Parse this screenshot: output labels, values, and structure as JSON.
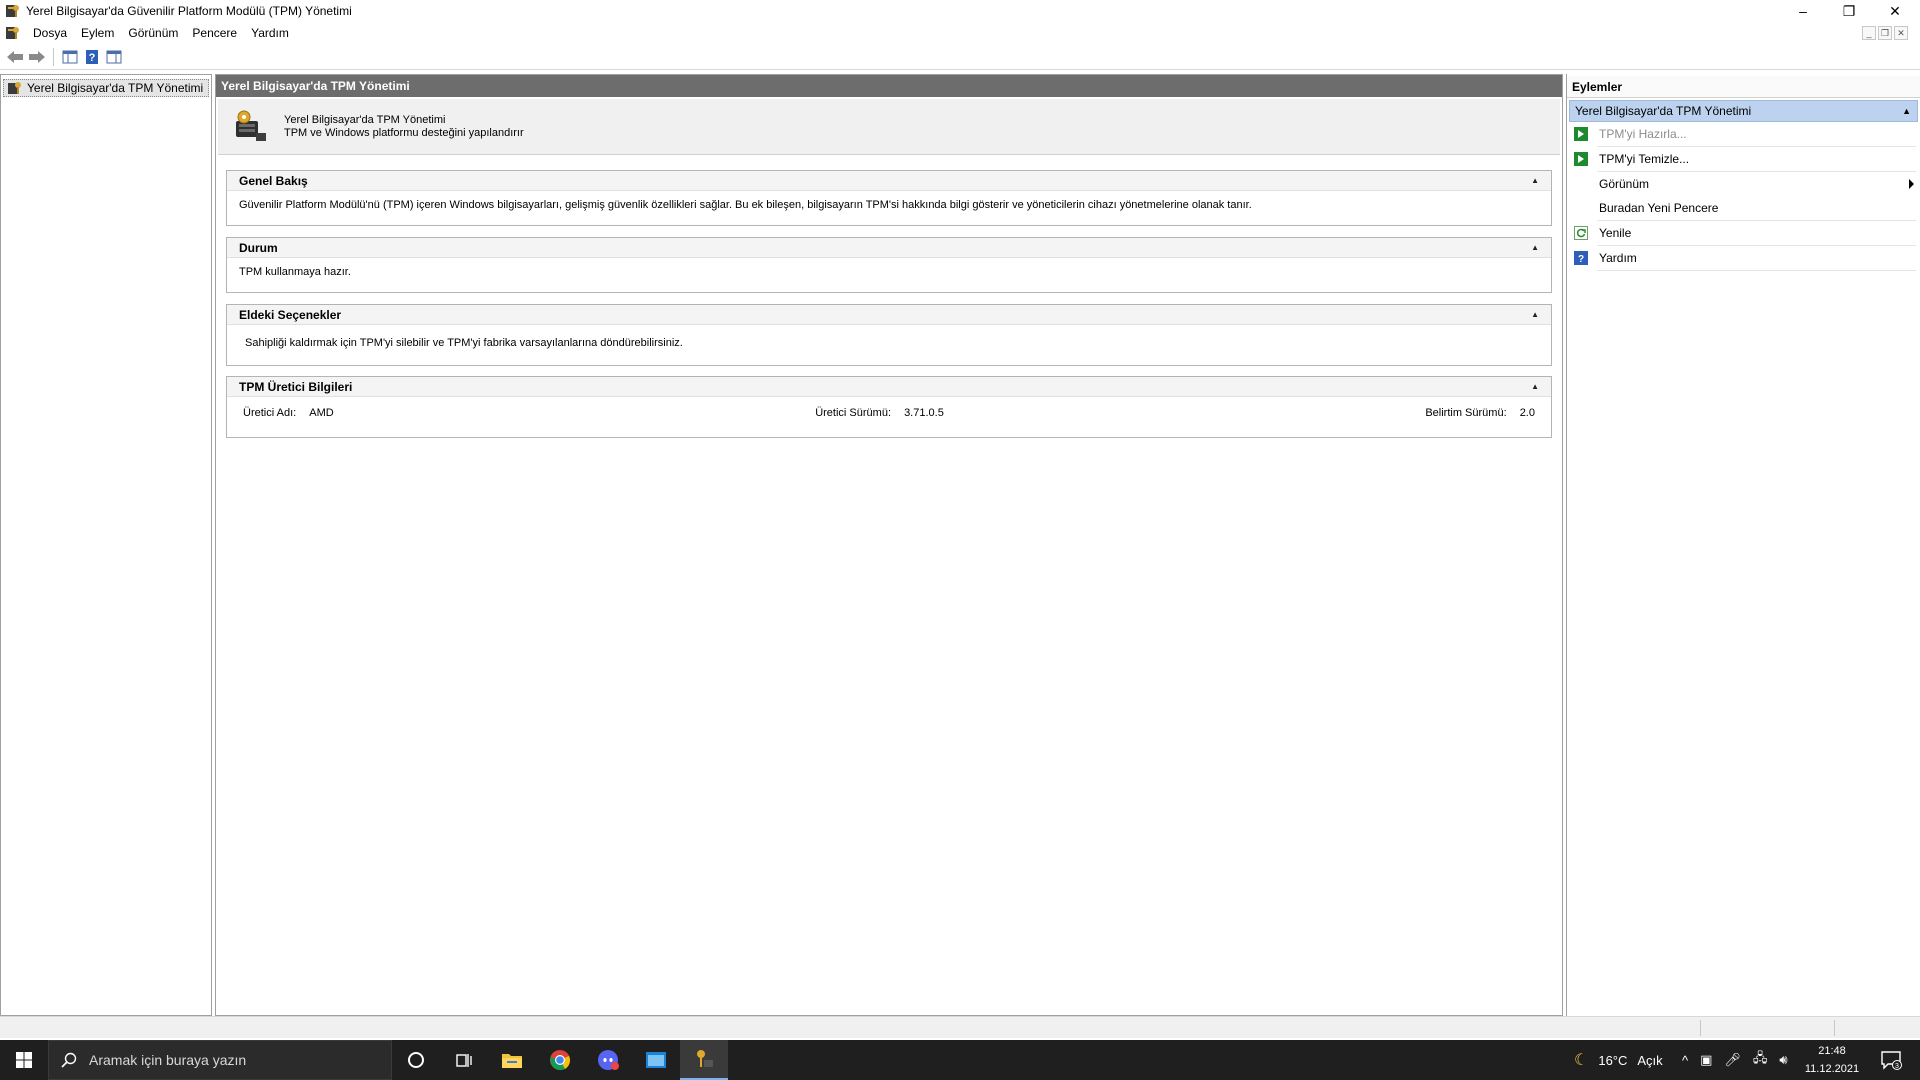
{
  "window": {
    "title": "Yerel Bilgisayar'da Güvenilir Platform Modülü (TPM) Yönetimi",
    "minimize_glyph": "–",
    "maximize_glyph": "❐",
    "close_glyph": "✕",
    "mdi_minimize_glyph": "_",
    "mdi_restore_glyph": "❐",
    "mdi_close_glyph": "✕"
  },
  "menubar": {
    "items": [
      "Dosya",
      "Eylem",
      "Görünüm",
      "Pencere",
      "Yardım"
    ]
  },
  "toolbar": {
    "buttons": [
      "back-icon",
      "forward-icon",
      "show-hide-tree-icon",
      "help-icon",
      "show-hide-action-pane-icon"
    ]
  },
  "tree": {
    "root_label": "Yerel Bilgisayar'da TPM Yönetimi"
  },
  "center": {
    "header": "Yerel Bilgisayar'da TPM Yönetimi",
    "banner_line1": "Yerel Bilgisayar'da TPM Yönetimi",
    "banner_line2": "TPM ve Windows platformu desteğini yapılandırır",
    "sections": {
      "overview": {
        "title": "Genel Bakış",
        "body": "Güvenilir Platform Modülü'nü (TPM) içeren Windows bilgisayarları, gelişmiş güvenlik özellikleri sağlar. Bu ek bileşen, bilgisayarın TPM'si hakkında bilgi gösterir ve yöneticilerin cihazı yönetmelerine olanak tanır."
      },
      "status": {
        "title": "Durum",
        "body": "TPM kullanmaya hazır."
      },
      "options": {
        "title": "Eldeki Seçenekler",
        "body": "Sahipliği kaldırmak için TPM'yi silebilir ve TPM'yi fabrika varsayılanlarına döndürebilirsiniz."
      },
      "manufacturer": {
        "title": "TPM Üretici Bilgileri",
        "name_label": "Üretici Adı:",
        "name_value": "AMD",
        "version_label": "Üretici Sürümü:",
        "version_value": "3.71.0.5",
        "spec_label": "Belirtim Sürümü:",
        "spec_value": "2.0"
      }
    }
  },
  "actions": {
    "title": "Eylemler",
    "group_label": "Yerel Bilgisayar'da TPM Yönetimi",
    "items": {
      "prepare": "TPM'yi Hazırla...",
      "clear": "TPM'yi Temizle...",
      "view": "Görünüm",
      "new_window": "Buradan Yeni Pencere",
      "refresh": "Yenile",
      "help": "Yardım"
    }
  },
  "taskbar": {
    "search_placeholder": "Aramak için buraya yazın",
    "weather_temp": "16°C",
    "weather_desc": "Açık",
    "time": "21:48",
    "date": "11.12.2021",
    "notification_count": "3"
  },
  "colors": {
    "center_header_bg": "#6d6d6d",
    "actions_group_bg": "#bcd2ee",
    "taskbar_bg": "#1f1f1f",
    "action_green": "#1e8a2e"
  }
}
